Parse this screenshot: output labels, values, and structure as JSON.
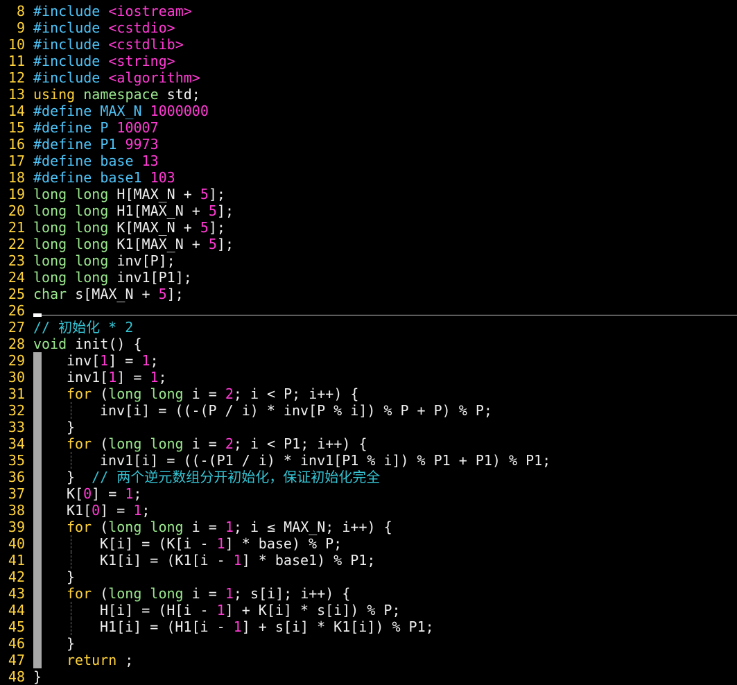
{
  "editor": {
    "lines": [
      {
        "n": "8",
        "indent": 0,
        "guide": false,
        "tokens": [
          [
            "pp",
            "#include "
          ],
          [
            "inc",
            "<iostream>"
          ]
        ]
      },
      {
        "n": "9",
        "indent": 0,
        "guide": false,
        "tokens": [
          [
            "pp",
            "#include "
          ],
          [
            "inc",
            "<cstdio>"
          ]
        ]
      },
      {
        "n": "10",
        "indent": 0,
        "guide": false,
        "tokens": [
          [
            "pp",
            "#include "
          ],
          [
            "inc",
            "<cstdlib>"
          ]
        ]
      },
      {
        "n": "11",
        "indent": 0,
        "guide": false,
        "tokens": [
          [
            "pp",
            "#include "
          ],
          [
            "inc",
            "<string>"
          ]
        ]
      },
      {
        "n": "12",
        "indent": 0,
        "guide": false,
        "tokens": [
          [
            "pp",
            "#include "
          ],
          [
            "inc",
            "<algorithm>"
          ]
        ]
      },
      {
        "n": "13",
        "indent": 0,
        "guide": false,
        "tokens": [
          [
            "kw",
            "using"
          ],
          [
            "txt",
            " "
          ],
          [
            "ty",
            "namespace"
          ],
          [
            "txt",
            " std;"
          ]
        ]
      },
      {
        "n": "14",
        "indent": 0,
        "guide": false,
        "tokens": [
          [
            "pp",
            "#define MAX_N "
          ],
          [
            "num",
            "1000000"
          ]
        ]
      },
      {
        "n": "15",
        "indent": 0,
        "guide": false,
        "tokens": [
          [
            "pp",
            "#define P "
          ],
          [
            "num",
            "10007"
          ]
        ]
      },
      {
        "n": "16",
        "indent": 0,
        "guide": false,
        "tokens": [
          [
            "pp",
            "#define P1 "
          ],
          [
            "num",
            "9973"
          ]
        ]
      },
      {
        "n": "17",
        "indent": 0,
        "guide": false,
        "tokens": [
          [
            "pp",
            "#define base "
          ],
          [
            "num",
            "13"
          ]
        ]
      },
      {
        "n": "18",
        "indent": 0,
        "guide": false,
        "tokens": [
          [
            "pp",
            "#define base1 "
          ],
          [
            "num",
            "103"
          ]
        ]
      },
      {
        "n": "19",
        "indent": 0,
        "guide": false,
        "tokens": [
          [
            "ty",
            "long long"
          ],
          [
            "txt",
            " H[MAX_N + "
          ],
          [
            "num",
            "5"
          ],
          [
            "txt",
            "];"
          ]
        ]
      },
      {
        "n": "20",
        "indent": 0,
        "guide": false,
        "tokens": [
          [
            "ty",
            "long long"
          ],
          [
            "txt",
            " H1[MAX_N + "
          ],
          [
            "num",
            "5"
          ],
          [
            "txt",
            "];"
          ]
        ]
      },
      {
        "n": "21",
        "indent": 0,
        "guide": false,
        "tokens": [
          [
            "ty",
            "long long"
          ],
          [
            "txt",
            " K[MAX_N + "
          ],
          [
            "num",
            "5"
          ],
          [
            "txt",
            "];"
          ]
        ]
      },
      {
        "n": "22",
        "indent": 0,
        "guide": false,
        "tokens": [
          [
            "ty",
            "long long"
          ],
          [
            "txt",
            " K1[MAX_N + "
          ],
          [
            "num",
            "5"
          ],
          [
            "txt",
            "];"
          ]
        ]
      },
      {
        "n": "23",
        "indent": 0,
        "guide": false,
        "tokens": [
          [
            "ty",
            "long long"
          ],
          [
            "txt",
            " inv[P];"
          ]
        ]
      },
      {
        "n": "24",
        "indent": 0,
        "guide": false,
        "tokens": [
          [
            "ty",
            "long long"
          ],
          [
            "txt",
            " inv1[P1];"
          ]
        ]
      },
      {
        "n": "25",
        "indent": 0,
        "guide": false,
        "tokens": [
          [
            "ty",
            "char"
          ],
          [
            "txt",
            " s[MAX_N + "
          ],
          [
            "num",
            "5"
          ],
          [
            "txt",
            "];"
          ]
        ]
      },
      {
        "n": "26",
        "indent": 0,
        "guide": false,
        "tokens": []
      },
      {
        "n": "27",
        "indent": 0,
        "guide": false,
        "tokens": [
          [
            "cm",
            "// 初始化 * 2"
          ]
        ]
      },
      {
        "n": "28",
        "indent": 0,
        "guide": false,
        "tokens": [
          [
            "ty",
            "void"
          ],
          [
            "txt",
            " init() {"
          ]
        ]
      },
      {
        "n": "29",
        "indent": 1,
        "guide": false,
        "tokens": [
          [
            "txt",
            "inv["
          ],
          [
            "num",
            "1"
          ],
          [
            "txt",
            "] = "
          ],
          [
            "num",
            "1"
          ],
          [
            "txt",
            ";"
          ]
        ]
      },
      {
        "n": "30",
        "indent": 1,
        "guide": false,
        "tokens": [
          [
            "txt",
            "inv1["
          ],
          [
            "num",
            "1"
          ],
          [
            "txt",
            "] = "
          ],
          [
            "num",
            "1"
          ],
          [
            "txt",
            ";"
          ]
        ]
      },
      {
        "n": "31",
        "indent": 1,
        "guide": false,
        "tokens": [
          [
            "kw",
            "for"
          ],
          [
            "txt",
            " ("
          ],
          [
            "ty",
            "long long"
          ],
          [
            "txt",
            " i = "
          ],
          [
            "num",
            "2"
          ],
          [
            "txt",
            "; i < P; i++) {"
          ]
        ]
      },
      {
        "n": "32",
        "indent": 2,
        "guide": true,
        "tokens": [
          [
            "txt",
            "inv[i] = ((-(P / i) * inv[P % i]) % P + P) % P;"
          ]
        ]
      },
      {
        "n": "33",
        "indent": 1,
        "guide": false,
        "tokens": [
          [
            "txt",
            "}"
          ]
        ]
      },
      {
        "n": "34",
        "indent": 1,
        "guide": false,
        "tokens": [
          [
            "kw",
            "for"
          ],
          [
            "txt",
            " ("
          ],
          [
            "ty",
            "long long"
          ],
          [
            "txt",
            " i = "
          ],
          [
            "num",
            "2"
          ],
          [
            "txt",
            "; i < P1; i++) {"
          ]
        ]
      },
      {
        "n": "35",
        "indent": 2,
        "guide": true,
        "tokens": [
          [
            "txt",
            "inv1[i] = ((-(P1 / i) * inv1[P1 % i]) % P1 + P1) % P1;"
          ]
        ]
      },
      {
        "n": "36",
        "indent": 1,
        "guide": false,
        "tokens": [
          [
            "txt",
            "}  "
          ],
          [
            "cm",
            "// 两个逆元数组分开初始化，保证初始化完全"
          ]
        ]
      },
      {
        "n": "37",
        "indent": 1,
        "guide": false,
        "tokens": [
          [
            "txt",
            "K["
          ],
          [
            "num",
            "0"
          ],
          [
            "txt",
            "] = "
          ],
          [
            "num",
            "1"
          ],
          [
            "txt",
            ";"
          ]
        ]
      },
      {
        "n": "38",
        "indent": 1,
        "guide": false,
        "tokens": [
          [
            "txt",
            "K1["
          ],
          [
            "num",
            "0"
          ],
          [
            "txt",
            "] = "
          ],
          [
            "num",
            "1"
          ],
          [
            "txt",
            ";"
          ]
        ]
      },
      {
        "n": "39",
        "indent": 1,
        "guide": false,
        "tokens": [
          [
            "kw",
            "for"
          ],
          [
            "txt",
            " ("
          ],
          [
            "ty",
            "long long"
          ],
          [
            "txt",
            " i = "
          ],
          [
            "num",
            "1"
          ],
          [
            "txt",
            "; i ≤ MAX_N; i++) {"
          ]
        ]
      },
      {
        "n": "40",
        "indent": 2,
        "guide": true,
        "tokens": [
          [
            "txt",
            "K[i] = (K[i - "
          ],
          [
            "num",
            "1"
          ],
          [
            "txt",
            "] * base) % P;"
          ]
        ]
      },
      {
        "n": "41",
        "indent": 2,
        "guide": true,
        "tokens": [
          [
            "txt",
            "K1[i] = (K1[i - "
          ],
          [
            "num",
            "1"
          ],
          [
            "txt",
            "] * base1) % P1;"
          ]
        ]
      },
      {
        "n": "42",
        "indent": 1,
        "guide": false,
        "tokens": [
          [
            "txt",
            "}"
          ]
        ]
      },
      {
        "n": "43",
        "indent": 1,
        "guide": false,
        "tokens": [
          [
            "kw",
            "for"
          ],
          [
            "txt",
            " ("
          ],
          [
            "ty",
            "long long"
          ],
          [
            "txt",
            " i = "
          ],
          [
            "num",
            "1"
          ],
          [
            "txt",
            "; s[i]; i++) {"
          ]
        ]
      },
      {
        "n": "44",
        "indent": 2,
        "guide": true,
        "tokens": [
          [
            "txt",
            "H[i] = (H[i - "
          ],
          [
            "num",
            "1"
          ],
          [
            "txt",
            "] + K[i] * s[i]) % P;"
          ]
        ]
      },
      {
        "n": "45",
        "indent": 2,
        "guide": true,
        "tokens": [
          [
            "txt",
            "H1[i] = (H1[i - "
          ],
          [
            "num",
            "1"
          ],
          [
            "txt",
            "] + s[i] * K1[i]) % P1;"
          ]
        ]
      },
      {
        "n": "46",
        "indent": 1,
        "guide": false,
        "tokens": [
          [
            "txt",
            "}"
          ]
        ]
      },
      {
        "n": "47",
        "indent": 1,
        "guide": false,
        "tokens": [
          [
            "kw",
            "return"
          ],
          [
            "txt",
            " ;"
          ]
        ]
      },
      {
        "n": "48",
        "indent": 0,
        "guide": false,
        "tokens": [
          [
            "txt",
            "}"
          ]
        ]
      }
    ]
  }
}
